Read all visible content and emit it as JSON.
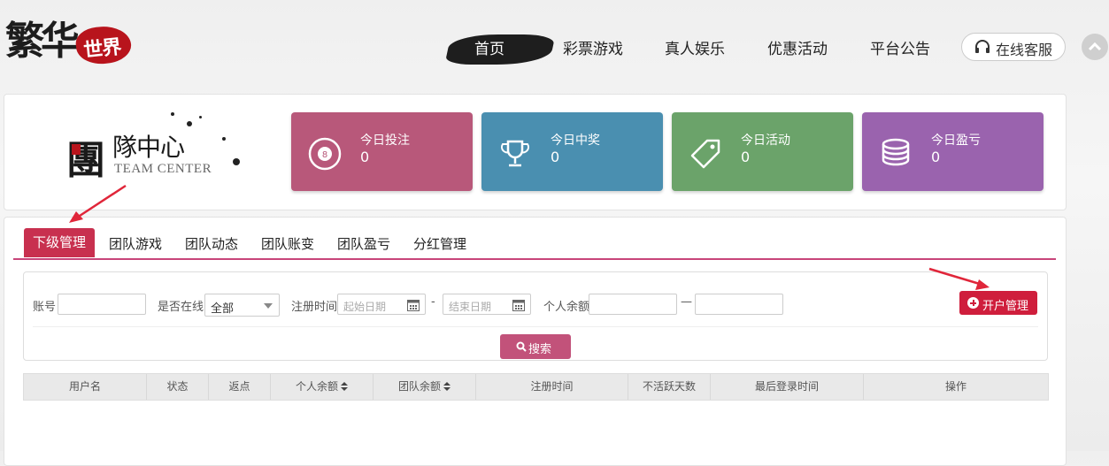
{
  "brand": {
    "logo_text_1": "繁华",
    "logo_text_2": "世界"
  },
  "nav": {
    "items": [
      "首页",
      "彩票游戏",
      "真人娱乐",
      "优惠活动",
      "平台公告"
    ],
    "customer_service": "在线客服"
  },
  "team_logo": {
    "title_char": "團",
    "title_rest": "隊中心",
    "subtitle": "TEAM CENTER"
  },
  "stats": [
    {
      "label": "今日投注",
      "value": "0",
      "icon": "billiard-ball-8-icon",
      "color": "#b8587a"
    },
    {
      "label": "今日中奖",
      "value": "0",
      "icon": "trophy-icon",
      "color": "#4a8fb0"
    },
    {
      "label": "今日活动",
      "value": "0",
      "icon": "tag-icon",
      "color": "#6ba36a"
    },
    {
      "label": "今日盈亏",
      "value": "0",
      "icon": "coins-stack-icon",
      "color": "#9a63ae"
    }
  ],
  "tabs": [
    "下级管理",
    "团队游戏",
    "团队动态",
    "团队账变",
    "团队盈亏",
    "分红管理"
  ],
  "filter": {
    "account_label": "账号",
    "online_label": "是否在线",
    "online_value": "全部",
    "reg_time_label": "注册时间",
    "start_date_placeholder": "起始日期",
    "range_sep": "-",
    "end_date_placeholder": "结束日期",
    "balance_label": "个人余额",
    "balance_sep": "—",
    "open_account_button": "开户管理",
    "search_button": "搜索"
  },
  "table": {
    "columns": [
      "用户名",
      "状态",
      "返点",
      "个人余额",
      "团队余额",
      "注册时间",
      "不活跃天数",
      "最后登录时间",
      "操作"
    ]
  },
  "colors": {
    "accent": "#c8304f",
    "tab_underline": "#c8457a",
    "search_button": "#c2527a",
    "open_button": "#cf1e3c"
  }
}
